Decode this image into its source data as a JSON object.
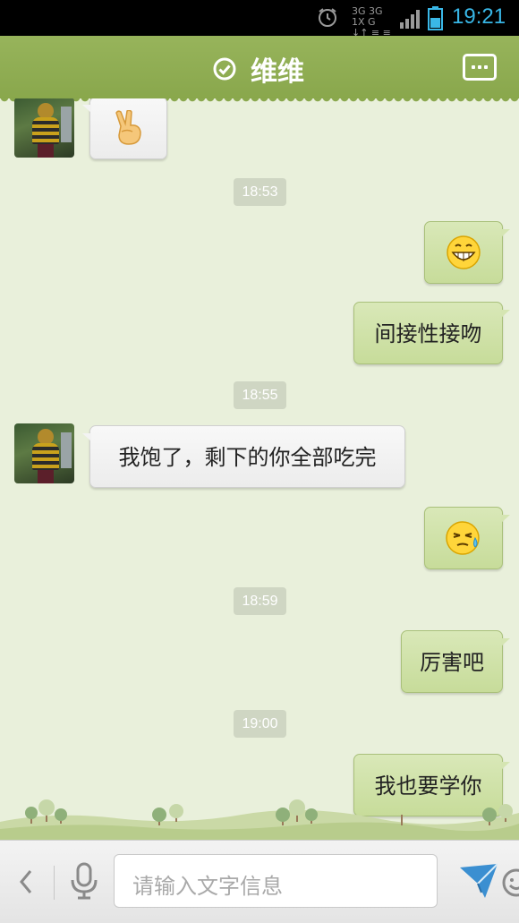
{
  "status_bar": {
    "time": "19:21",
    "network_top": "3G 3G 1X G",
    "network_bottom": "↓↑ ≡ ≡"
  },
  "header": {
    "title": "维维",
    "verified_icon": "check-circle-icon",
    "more_icon": "chat-more-icon"
  },
  "messages": [
    {
      "type": "incoming",
      "content": "✌",
      "kind": "emoji",
      "emoji_name": "victory-hand-icon"
    },
    {
      "type": "timestamp",
      "content": "18:53"
    },
    {
      "type": "outgoing",
      "content": "😁",
      "kind": "emoji",
      "emoji_name": "grin-face-icon"
    },
    {
      "type": "outgoing",
      "content": "间接性接吻",
      "kind": "text"
    },
    {
      "type": "timestamp",
      "content": "18:55"
    },
    {
      "type": "incoming",
      "content": "我饱了，剩下的你全部吃完",
      "kind": "text"
    },
    {
      "type": "outgoing",
      "content": "😓",
      "kind": "emoji",
      "emoji_name": "sweat-face-icon"
    },
    {
      "type": "timestamp",
      "content": "18:59"
    },
    {
      "type": "outgoing",
      "content": "厉害吧",
      "kind": "text"
    },
    {
      "type": "timestamp",
      "content": "19:00"
    },
    {
      "type": "outgoing",
      "content": "我也要学你",
      "kind": "text"
    }
  ],
  "input_bar": {
    "placeholder": "请输入文字信息",
    "back_icon": "chevron-left-icon",
    "mic_icon": "microphone-icon",
    "emoji_icon": "smiley-icon",
    "send_icon": "paper-plane-icon"
  },
  "colors": {
    "header": "#8fad52",
    "chat_background": "#e9f0db",
    "outgoing_bubble": "#d0e2a9",
    "incoming_bubble": "#f4f4f4",
    "status_time": "#38b6e6"
  }
}
